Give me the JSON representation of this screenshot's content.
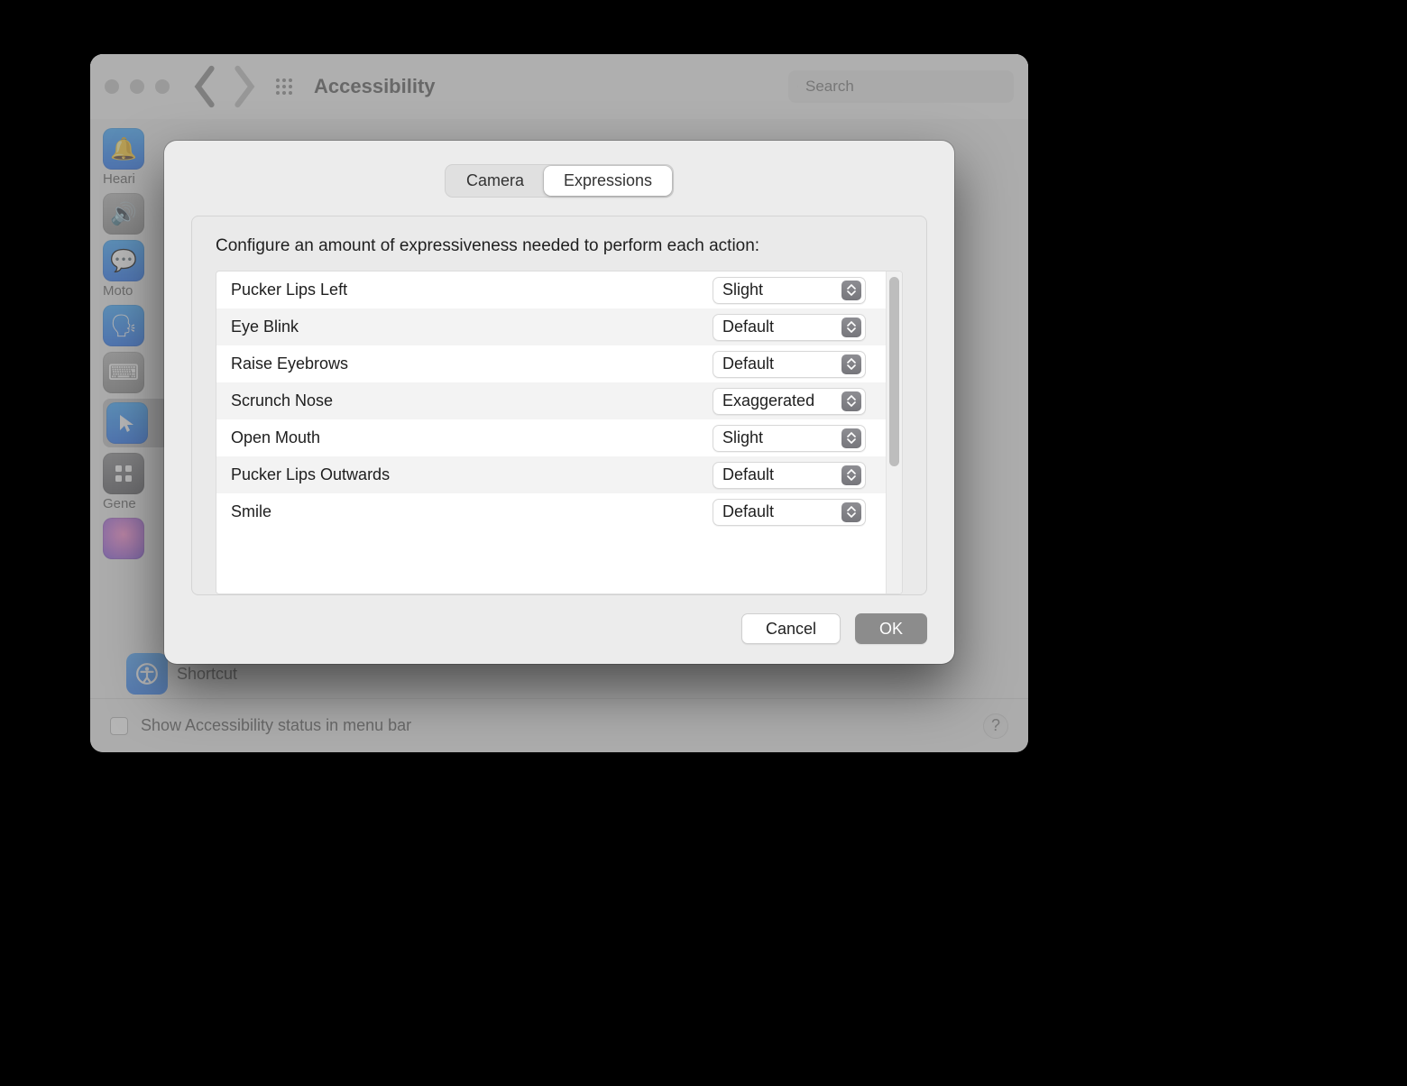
{
  "window": {
    "title": "Accessibility",
    "search_placeholder": "Search"
  },
  "sidebar": {
    "groups": [
      {
        "label": "Heari"
      },
      {
        "label": "Moto"
      },
      {
        "label": "Gene"
      }
    ],
    "shortcut_label": "Shortcut"
  },
  "footer": {
    "checkbox_label": "Show Accessibility status in menu bar",
    "help_label": "?"
  },
  "sheet": {
    "tabs": {
      "tab1": "Camera",
      "tab2": "Expressions"
    },
    "instruction": "Configure an amount of expressiveness needed to perform each action:",
    "rows": [
      {
        "name": "Pucker Lips Left",
        "value": "Slight"
      },
      {
        "name": "Eye Blink",
        "value": "Default"
      },
      {
        "name": "Raise Eyebrows",
        "value": "Default"
      },
      {
        "name": "Scrunch Nose",
        "value": "Exaggerated"
      },
      {
        "name": "Open Mouth",
        "value": "Slight"
      },
      {
        "name": "Pucker Lips Outwards",
        "value": "Default"
      },
      {
        "name": "Smile",
        "value": "Default"
      }
    ],
    "buttons": {
      "cancel": "Cancel",
      "ok": "OK"
    }
  }
}
